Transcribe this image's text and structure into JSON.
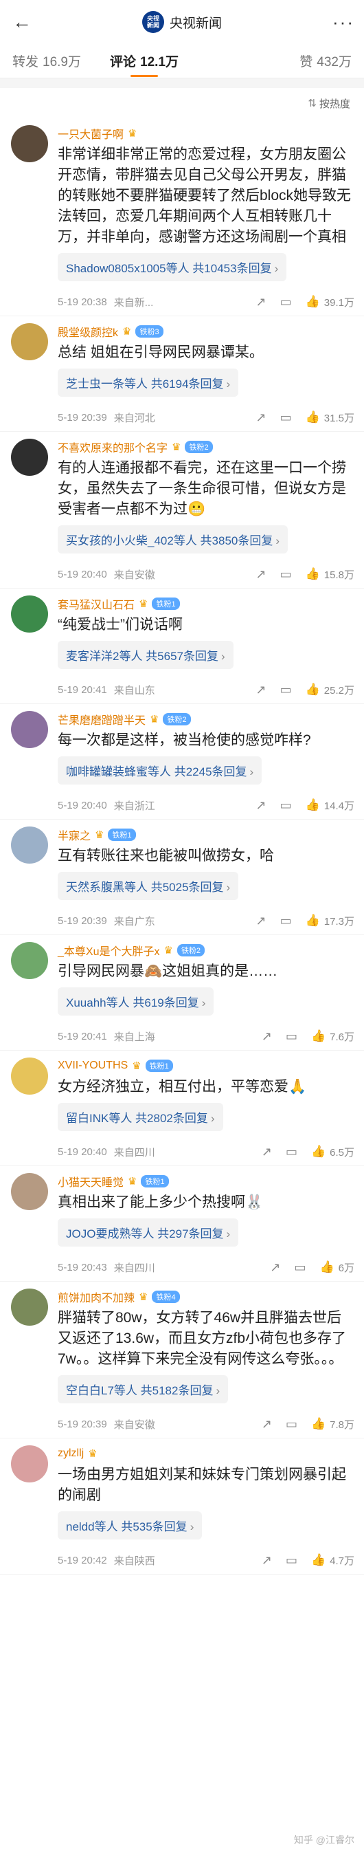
{
  "header": {
    "back_icon": "arrow-left-icon",
    "logo_text": "央视新闻",
    "title": "央视新闻",
    "more_icon": "more-dots-icon"
  },
  "tabs": [
    {
      "label": "转发",
      "value": "16.9万"
    },
    {
      "label": "评论",
      "value": "12.1万"
    },
    {
      "label": "赞",
      "value": "432万"
    }
  ],
  "sort": {
    "label": "按热度"
  },
  "comments": [
    {
      "user": "一只大菌子啊",
      "badge": "",
      "text": "非常详细非常正常的恋爱过程，女方朋友圈公开恋情，带胖猫去见自己父母公开男友，胖猫的转账她不要胖猫硬要转了然后block她导致无法转回，恋爱几年期间两个人互相转账几十万，并非单向，感谢警方还这场闹剧一个真相",
      "reply": "Shadow0805x1005等人  共10453条回复",
      "time": "5-19 20:38",
      "location": "来自新...",
      "likes": "39.1万",
      "avatar_color": "#5b4a3a"
    },
    {
      "user": "殿堂级颜控k",
      "badge": "铁粉3",
      "text": "总结 姐姐在引导网民网暴谭某。",
      "reply": "芝士虫一条等人  共6194条回复",
      "time": "5-19 20:39",
      "location": "来自河北",
      "likes": "31.5万",
      "avatar_color": "#c9a24a"
    },
    {
      "user": "不喜欢原来的那个名字",
      "badge": "铁粉2",
      "text": "有的人连通报都不看完，还在这里一口一个捞女，虽然失去了一条生命很可惜，但说女方是受害者一点都不为过😬",
      "reply": "买女孩的小火柴_402等人  共3850条回复",
      "time": "5-19 20:40",
      "location": "来自安徽",
      "likes": "15.8万",
      "avatar_color": "#2e2e2e"
    },
    {
      "user": "套马猛汉山石石",
      "badge": "铁粉1",
      "text": "“纯爱战士”们说话啊",
      "reply": "麦客洋洋2等人  共5657条回复",
      "time": "5-19 20:41",
      "location": "来自山东",
      "likes": "25.2万",
      "avatar_color": "#3c8a4a"
    },
    {
      "user": "芒果磨磨蹭蹭半天",
      "badge": "铁粉2",
      "text": "每一次都是这样，被当枪使的感觉咋样?",
      "reply": "咖啡罐罐装蜂蜜等人  共2245条回复",
      "time": "5-19 20:40",
      "location": "来自浙江",
      "likes": "14.4万",
      "avatar_color": "#8a6f9e"
    },
    {
      "user": "半寐之",
      "badge": "铁粉1",
      "text": "互有转账往来也能被叫做捞女，哈",
      "reply": "天然系腹黑等人  共5025条回复",
      "time": "5-19 20:39",
      "location": "来自广东",
      "likes": "17.3万",
      "avatar_color": "#9bb0c8"
    },
    {
      "user": "_本尊Xu是个大胖子x",
      "badge": "铁粉2",
      "text": "引导网民网暴🙈这姐姐真的是……",
      "reply": "Xuuahh等人  共619条回复",
      "time": "5-19 20:41",
      "location": "来自上海",
      "likes": "7.6万",
      "avatar_color": "#6fa86a"
    },
    {
      "user": "XVII-YOUTHS",
      "badge": "铁粉1",
      "text": "女方经济独立，相互付出，平等恋爱🙏",
      "reply": "留白INK等人  共2802条回复",
      "time": "5-19 20:40",
      "location": "来自四川",
      "likes": "6.5万",
      "avatar_color": "#e6c35a"
    },
    {
      "user": "小猫天天睡觉",
      "badge": "铁粉1",
      "text": "真相出来了能上多少个热搜啊🐰",
      "reply": "JOJO要成熟等人  共297条回复",
      "time": "5-19 20:43",
      "location": "来自四川",
      "likes": "6万",
      "avatar_color": "#b59a82"
    },
    {
      "user": "煎饼加肉不加辣",
      "badge": "铁粉4",
      "text": "胖猫转了80w，女方转了46w并且胖猫去世后又返还了13.6w，而且女方zfb小荷包也多存了7w。。这样算下来完全没有网传这么夸张。。。",
      "reply": "空白白L7等人  共5182条回复",
      "time": "5-19 20:39",
      "location": "来自安徽",
      "likes": "7.8万",
      "avatar_color": "#7a8a5a"
    },
    {
      "user": "zylzllj",
      "badge": "",
      "text": "一场由男方姐姐刘某和妹妹专门策划网暴引起的闹剧",
      "reply": "neldd等人  共535条回复",
      "time": "5-19 20:42",
      "location": "来自陕西",
      "likes": "4.7万",
      "avatar_color": "#d9a0a0"
    }
  ],
  "watermark": "知乎 @江睿尔"
}
